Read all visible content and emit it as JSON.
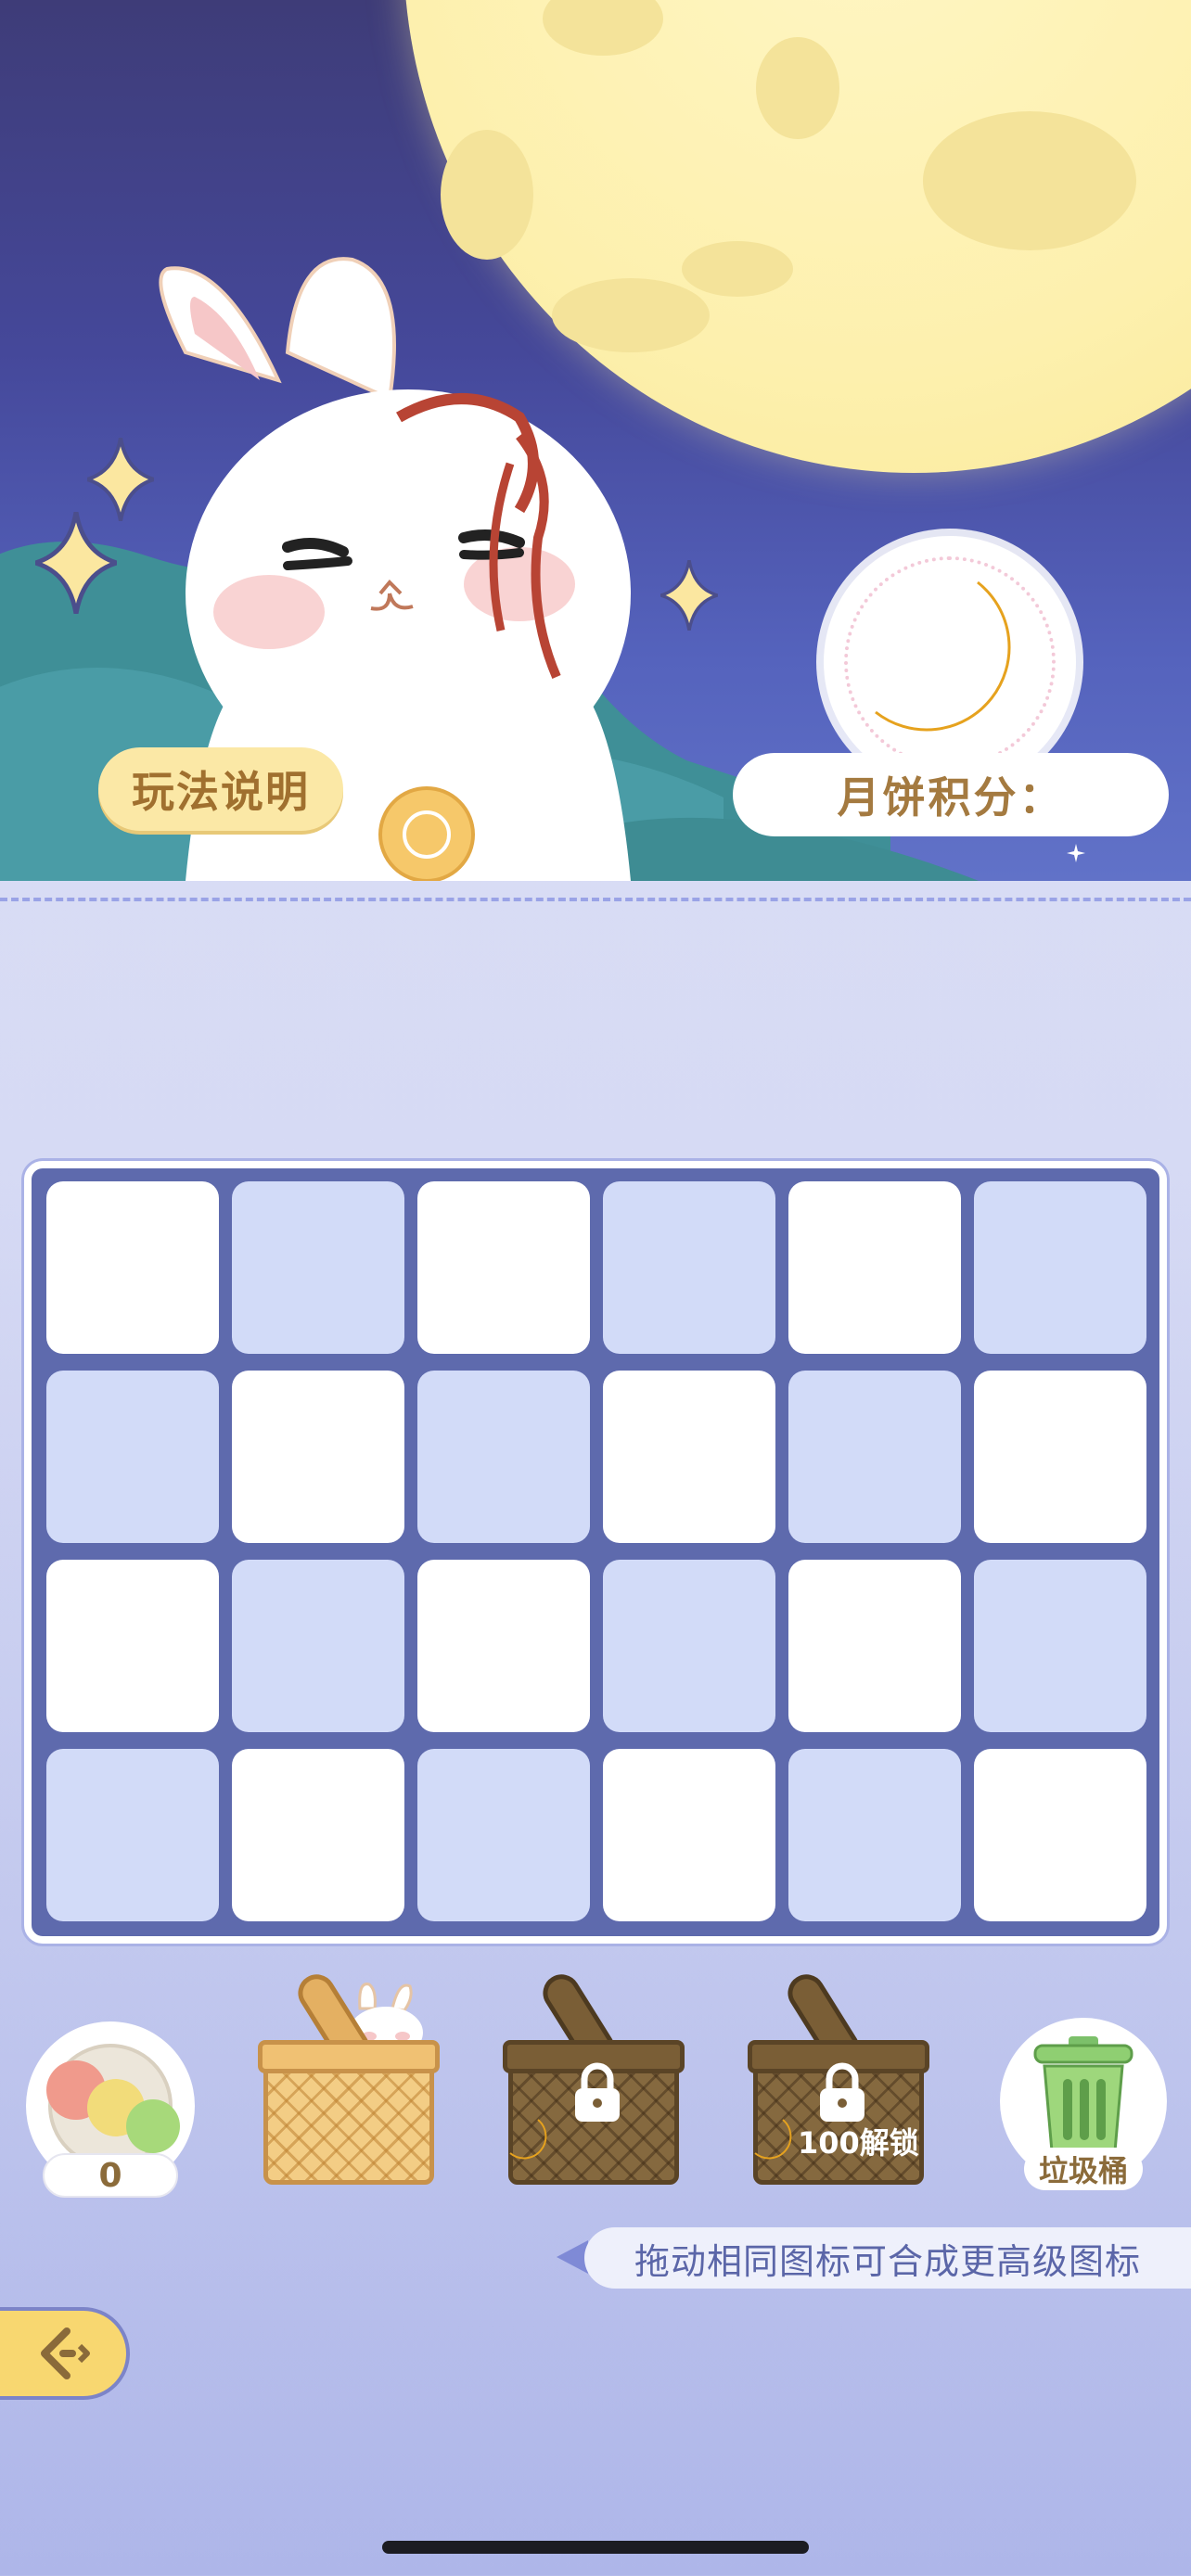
{
  "header": {
    "help_button_label": "玩法说明",
    "score_label": "月饼积分："
  },
  "grid": {
    "rows": 4,
    "cols": 6,
    "cells": [
      [
        "light",
        "blue",
        "light",
        "blue",
        "light",
        "blue"
      ],
      [
        "blue",
        "light",
        "blue",
        "light",
        "blue",
        "light"
      ],
      [
        "light",
        "blue",
        "light",
        "blue",
        "light",
        "blue"
      ],
      [
        "blue",
        "light",
        "blue",
        "light",
        "blue",
        "light"
      ]
    ]
  },
  "tray": {
    "dango_count": "0",
    "basket_locked_1_icon": "lock-icon",
    "basket_locked_2_unlock_label": "100解锁",
    "trash_label": "垃圾桶"
  },
  "hint": {
    "text": "拖动相同图标可合成更高级图标"
  },
  "colors": {
    "sky_top": "#3e3c78",
    "moon": "#fdf0ad",
    "accent_yellow": "#f8d770",
    "grid_frame": "#5e6aad",
    "cell_blue": "#d2dbf8"
  }
}
